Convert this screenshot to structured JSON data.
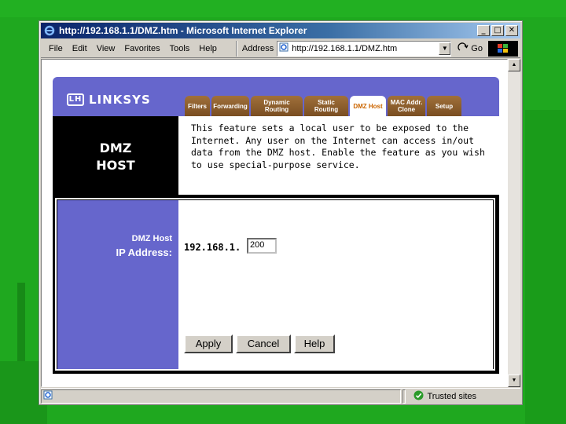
{
  "window": {
    "title": "http://192.168.1.1/DMZ.htm - Microsoft Internet Explorer",
    "controls": {
      "minimize": "_",
      "maximize": "□",
      "close": "✕"
    }
  },
  "menubar": {
    "items": [
      "File",
      "Edit",
      "View",
      "Favorites",
      "Tools",
      "Help"
    ],
    "address_label": "Address",
    "address_value": "http://192.168.1.1/DMZ.htm",
    "go_label": "Go"
  },
  "status": {
    "zone": "Trusted sites"
  },
  "page": {
    "logo": "LINKSYS",
    "logo_mark": "LH",
    "tabs": [
      {
        "label": "Filters",
        "active": false
      },
      {
        "label": "Forwarding",
        "active": false
      },
      {
        "label": "Dynamic Routing",
        "active": false
      },
      {
        "label": "Static Routing",
        "active": false
      },
      {
        "label": "DMZ Host",
        "active": true
      },
      {
        "label": "MAC Addr. Clone",
        "active": false
      },
      {
        "label": "Setup",
        "active": false
      }
    ],
    "section_title_line1": "DMZ",
    "section_title_line2": "HOST",
    "description": "This feature sets a local user to be exposed to the Internet. Any user on the Internet can access in/out data from the DMZ host. Enable the feature as you wish to use special-purpose service.",
    "label_line1": "DMZ Host",
    "label_line2": "IP Address:",
    "ip_prefix": "192.168.1.",
    "ip_value": "200",
    "buttons": {
      "apply": "Apply",
      "cancel": "Cancel",
      "help": "Help"
    }
  },
  "colors": {
    "slide_bg": "#1fa81f",
    "linksys_purple": "#6666cc",
    "tab_brown": "#996633",
    "ie_titlebar": "#0a246a"
  },
  "icons": {
    "title": "ie-logo-icon",
    "address": "ie-page-icon",
    "go": "go-arrow-icon",
    "status_page": "ie-page-icon",
    "status_zone": "trusted-check-icon",
    "flag": "windows-flag-icon"
  }
}
